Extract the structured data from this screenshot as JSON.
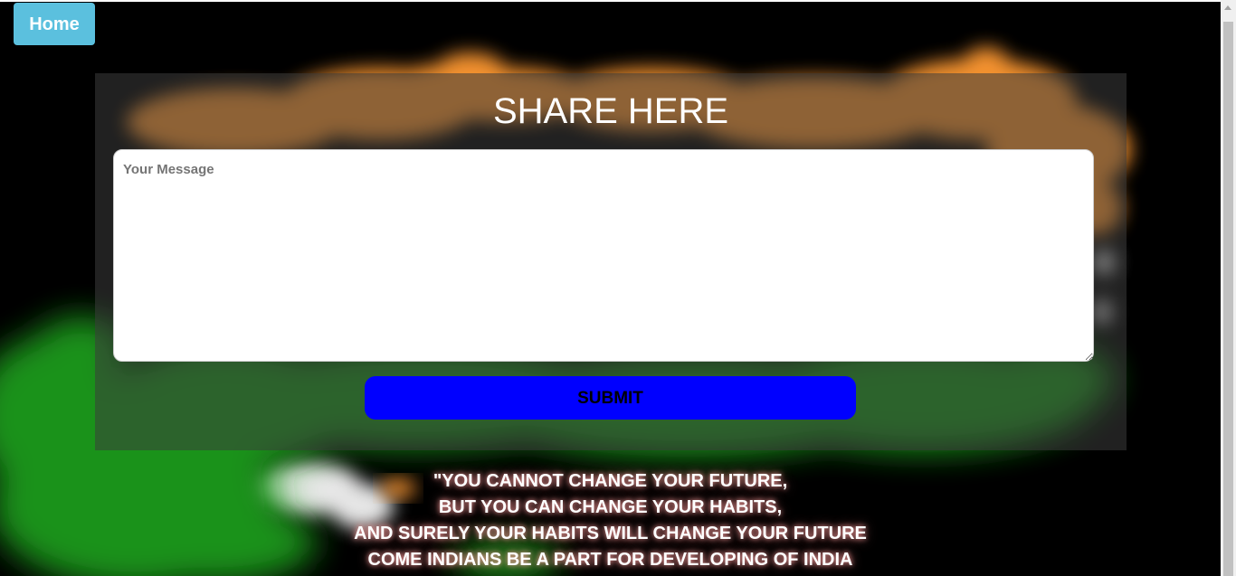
{
  "nav": {
    "home_label": "Home"
  },
  "form": {
    "title": "SHARE HERE",
    "message_placeholder": "Your Message",
    "message_value": "",
    "submit_label": "SUBMIT"
  },
  "quote": {
    "lines": [
      "\"YOU CANNOT CHANGE YOUR FUTURE,",
      "BUT YOU CAN CHANGE YOUR HABITS,",
      "AND SURELY YOUR HABITS WILL CHANGE YOUR FUTURE",
      "COME INDIANS BE A PART FOR DEVELOPING OF INDIA"
    ]
  },
  "colors": {
    "page_background": "#000000",
    "home_button": "#5bc0de",
    "submit_button": "#0000ff",
    "smoke_saffron": "#ff9933",
    "smoke_white": "#f2f2f2",
    "smoke_green": "#138808"
  },
  "icons": {
    "scroll_up": "triangle-up"
  }
}
